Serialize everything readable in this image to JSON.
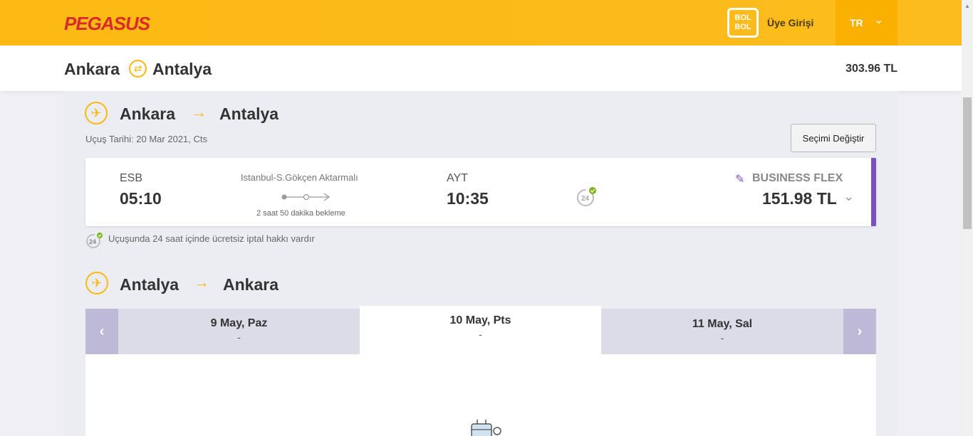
{
  "header": {
    "logo": "PEGASUS",
    "bolbol": "BOL BOL",
    "login": "Üye Girişi",
    "lang": "TR"
  },
  "route_bar": {
    "from": "Ankara",
    "to": "Antalya",
    "total_price": "303.96 TL"
  },
  "outbound": {
    "from": "Ankara",
    "to": "Antalya",
    "date": "Uçuş Tarihi: 20 Mar 2021, Cts",
    "change_label": "Seçimi Değiştir",
    "flight": {
      "dep_code": "ESB",
      "dep_time": "05:10",
      "stopover": "Istanbul-S.Gökçen Aktarmalı",
      "wait": "2 saat 50 dakika bekleme",
      "arr_code": "AYT",
      "arr_time": "10:35",
      "fare_class": "BUSINESS FLEX",
      "price": "151.98 TL"
    },
    "cancel_info": "Uçuşunda 24 saat içinde ücretsiz iptal hakkı vardır"
  },
  "return": {
    "from": "Antalya",
    "to": "Ankara",
    "days": [
      {
        "label": "9 May, Paz",
        "price": "-"
      },
      {
        "label": "10 May, Pts",
        "price": "-"
      },
      {
        "label": "11 May, Sal",
        "price": "-"
      }
    ]
  },
  "colors": {
    "brand_yellow": "#fdb913",
    "brand_red": "#d92b2b",
    "accent_purple": "#7d4fbf"
  }
}
